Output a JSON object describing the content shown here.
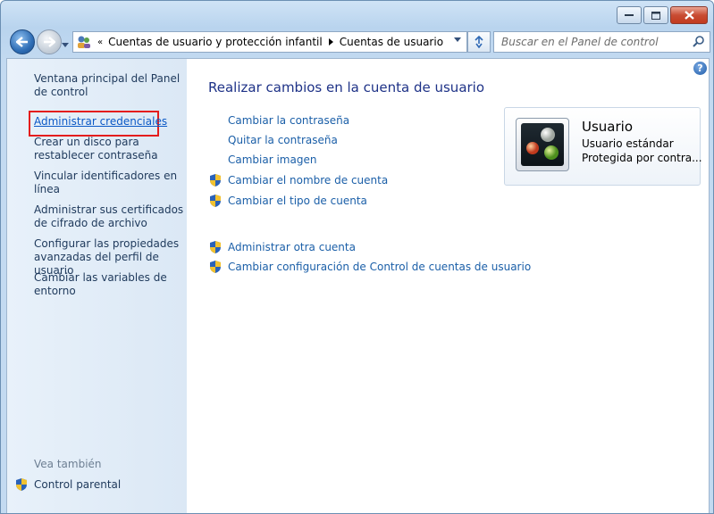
{
  "window": {
    "caption_buttons": [
      "minimize-icon",
      "maximize-icon",
      "close-icon"
    ]
  },
  "navigation": {
    "breadcrumb_prefix": "«",
    "breadcrumb": [
      "Cuentas de usuario y protección infantil",
      "Cuentas de usuario"
    ],
    "search_placeholder": "Buscar en el Panel de control"
  },
  "sidebar": {
    "items": [
      "Ventana principal del Panel de control",
      "Administrar credenciales",
      "Crear un disco para restablecer contraseña",
      "Vincular identificadores en línea",
      "Administrar sus certificados de cifrado de archivo",
      "Configurar las propiedades avanzadas del perfil de usuario",
      "Cambiar las variables de entorno"
    ],
    "see_also_label": "Vea también",
    "see_also_items": [
      "Control parental"
    ]
  },
  "main": {
    "help_label": "?",
    "title": "Realizar cambios en la cuenta de usuario",
    "tasks": [
      {
        "label": "Cambiar la contraseña",
        "shield": false
      },
      {
        "label": "Quitar la contraseña",
        "shield": false
      },
      {
        "label": "Cambiar imagen",
        "shield": false
      },
      {
        "label": "Cambiar el nombre de cuenta",
        "shield": true
      },
      {
        "label": "Cambiar el tipo de cuenta",
        "shield": true
      }
    ],
    "other_tasks": [
      {
        "label": "Administrar otra cuenta",
        "shield": true
      },
      {
        "label": "Cambiar configuración de Control de cuentas de usuario",
        "shield": true
      }
    ]
  },
  "account": {
    "name": "Usuario",
    "type": "Usuario estándar",
    "status": "Protegida por contra..."
  },
  "colors": {
    "link": "#1b5fa8",
    "title": "#1e3287",
    "highlight_box": "#e41d1d",
    "sidebar_text": "#1e395b"
  }
}
